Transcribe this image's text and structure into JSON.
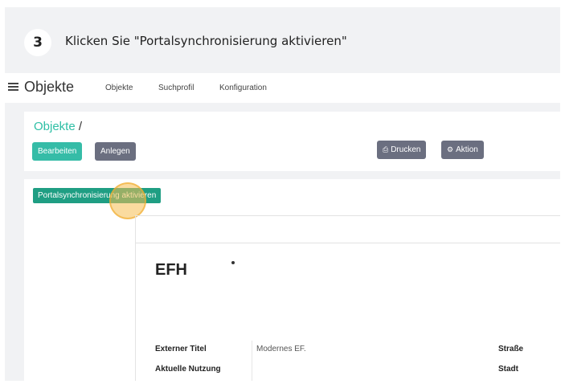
{
  "step": {
    "number": "3",
    "instruction": "Klicken Sie \"Portalsynchronisierung aktivieren\""
  },
  "topnav": {
    "brand": "Objekte",
    "links": [
      "Objekte",
      "Suchprofil",
      "Konfiguration"
    ]
  },
  "header": {
    "breadcrumb_link": "Objekte",
    "breadcrumb_sep": "/",
    "buttons": {
      "edit": "Bearbeiten",
      "create": "Anlegen",
      "print": "Drucken",
      "action": "Aktion"
    }
  },
  "main": {
    "sync_button": "Portalsynchronisierung aktivieren",
    "object_title": "EFH",
    "fields": [
      {
        "label": "Externer Titel",
        "value": "Modernes EF."
      },
      {
        "label": "Aktuelle Nutzung",
        "value": ""
      }
    ],
    "right_fields": [
      "Straße",
      "Stadt"
    ]
  },
  "colors": {
    "accent": "#35bca7",
    "sync": "#1f9e83",
    "gray_button": "#6b6f80",
    "highlight": "#f5be50"
  },
  "icons": {
    "menu": "hamburger-menu-icon",
    "print": "printer-icon",
    "action": "gear-icon"
  }
}
